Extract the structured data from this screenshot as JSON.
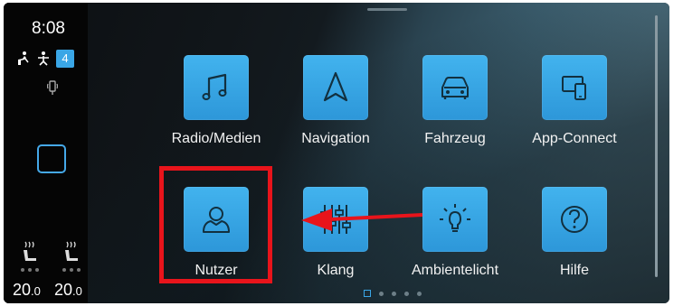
{
  "status": {
    "time": "8:08",
    "user_number": "4"
  },
  "climate": {
    "left_temp_int": "20",
    "left_temp_dec": ".0",
    "right_temp_int": "20",
    "right_temp_dec": ".0"
  },
  "menu": {
    "items": [
      {
        "label": "Radio/Medien",
        "icon": "music-note-icon"
      },
      {
        "label": "Navigation",
        "icon": "navigation-arrow-icon"
      },
      {
        "label": "Fahrzeug",
        "icon": "car-icon"
      },
      {
        "label": "App-Connect",
        "icon": "app-connect-icon"
      },
      {
        "label": "Nutzer",
        "icon": "user-icon"
      },
      {
        "label": "Klang",
        "icon": "equalizer-icon"
      },
      {
        "label": "Ambientelicht",
        "icon": "lightbulb-icon"
      },
      {
        "label": "Hilfe",
        "icon": "help-icon"
      }
    ]
  },
  "pagination": {
    "total_pages": 5,
    "current_page": 1
  },
  "annotation": {
    "highlight_color": "#e8141b",
    "highlighted_item": "Nutzer"
  },
  "colors": {
    "accent": "#3aa6e6",
    "tile": "#35a3e4"
  }
}
